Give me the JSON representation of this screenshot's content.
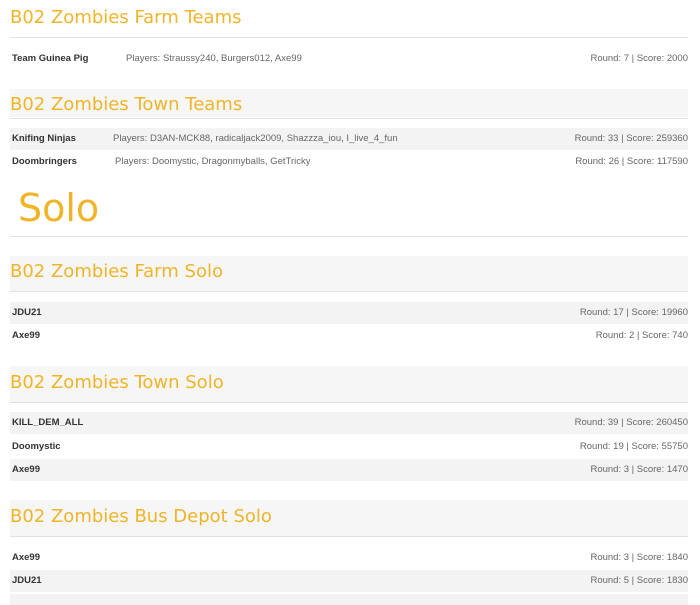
{
  "colors": {
    "accent": "#f0b429",
    "row_shade": "#f3f3f3",
    "divider": "#e2e2e2"
  },
  "farm_teams": {
    "title": "B02 Zombies Farm Teams",
    "rows": [
      {
        "name": "Team Guinea Pig",
        "players": "Players: Straussy240, Burgers012, Axe99",
        "score": "Round: 7 | Score: 2000"
      }
    ]
  },
  "town_teams": {
    "title": "B02 Zombies Town Teams",
    "rows": [
      {
        "name": "Knifing Ninjas",
        "players": "Players: D3AN-MCK88, radicaljack2009, Shazzza_iou, I_live_4_fun",
        "score": "Round: 33 | Score: 259360"
      },
      {
        "name": "Doombringers",
        "players": "Players: Doomystic, Dragonmyballs, GetTricky",
        "score": "Round: 26 | Score: 117590"
      }
    ]
  },
  "solo_heading": "Solo",
  "farm_solo": {
    "title": "B02 Zombies Farm Solo",
    "rows": [
      {
        "name": "JDU21",
        "score": "Round: 17 | Score: 19960"
      },
      {
        "name": "Axe99",
        "score": "Round: 2 | Score: 740"
      }
    ]
  },
  "town_solo": {
    "title": "B02 Zombies Town Solo",
    "rows": [
      {
        "name": "KILL_DEM_ALL",
        "score": "Round: 39 | Score: 260450"
      },
      {
        "name": "Doomystic",
        "score": "Round: 19 | Score: 55750"
      },
      {
        "name": "Axe99",
        "score": "Round: 3 | Score: 1470"
      }
    ]
  },
  "bus_depot_solo": {
    "title": "B02 Zombies Bus Depot Solo",
    "rows": [
      {
        "name": "Axe99",
        "score": "Round: 3 | Score: 1840"
      },
      {
        "name": "JDU21",
        "score": "Round: 5 | Score: 1830"
      }
    ]
  }
}
